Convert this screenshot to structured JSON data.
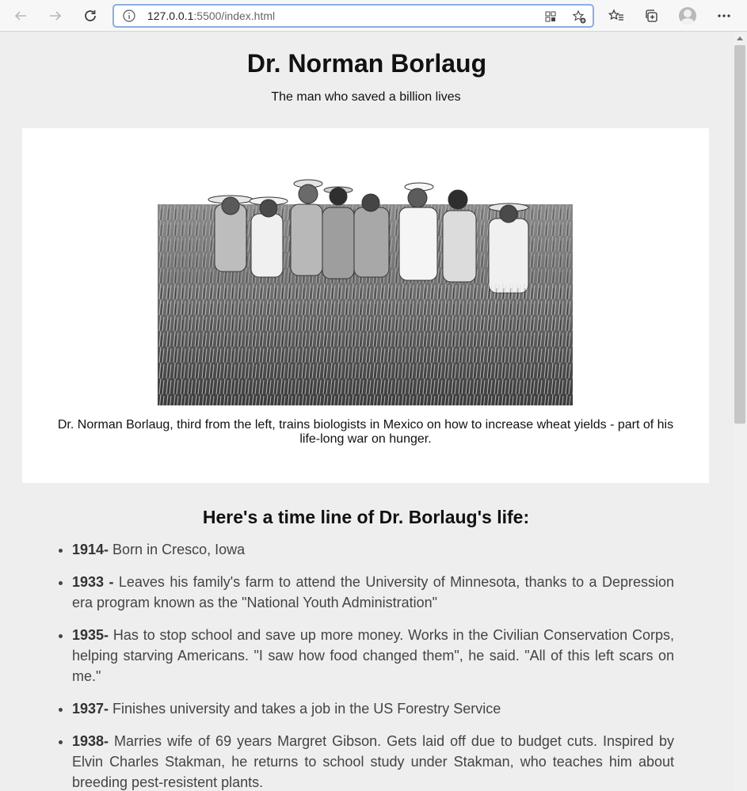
{
  "browser": {
    "url_host": "127.0.0.1",
    "url_rest": ":5500/index.html"
  },
  "page": {
    "title": "Dr. Norman Borlaug",
    "subtitle": "The man who saved a billion lives",
    "caption": "Dr. Norman Borlaug, third from the left, trains biologists in Mexico on how to increase wheat yields - part of his life-long war on hunger.",
    "timeline_heading": "Here's a time line of Dr. Borlaug's life:",
    "timeline": [
      {
        "year": "1914-",
        "text": " Born in Cresco, Iowa"
      },
      {
        "year": "1933 -",
        "text": " Leaves his family's farm to attend the University of Minnesota, thanks to a Depression era program known as the \"National Youth Administration\""
      },
      {
        "year": "1935-",
        "text": " Has to stop school and save up more money. Works in the Civilian Conservation Corps, helping starving Americans. \"I saw how food changed them\", he said. \"All of this left scars on me.\""
      },
      {
        "year": "1937-",
        "text": " Finishes university and takes a job in the US Forestry Service"
      },
      {
        "year": "1938-",
        "text": " Marries wife of 69 years Margret Gibson. Gets laid off due to budget cuts. Inspired by Elvin Charles Stakman, he returns to school study under Stakman, who teaches him about breeding pest-resistent plants."
      }
    ]
  }
}
